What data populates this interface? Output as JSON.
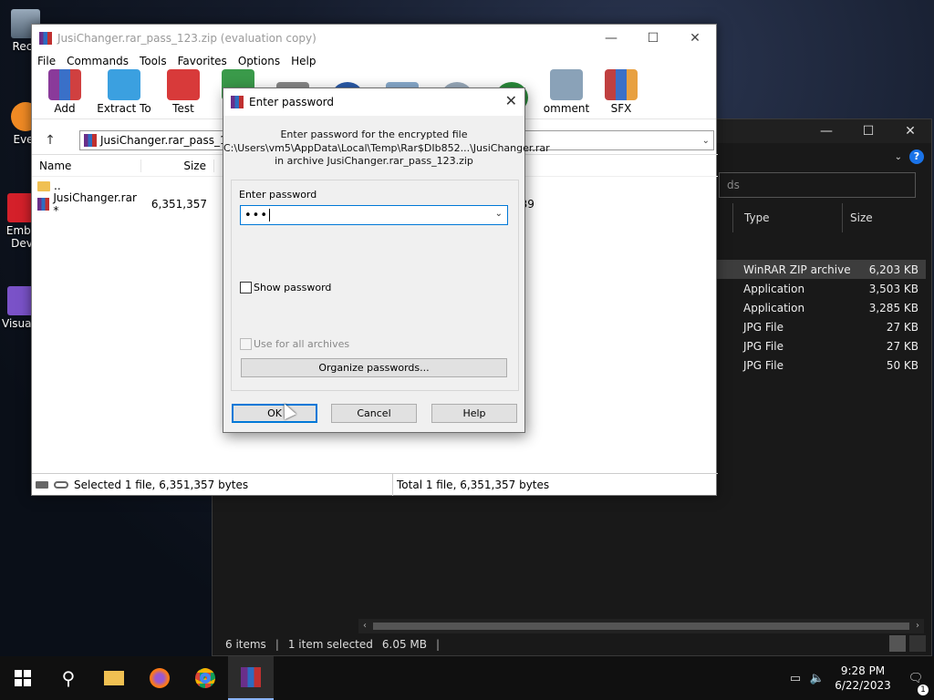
{
  "desktop": {
    "icons": [
      {
        "label": "Recy"
      },
      {
        "label": "Ever"
      },
      {
        "label": "Emba Dev"
      },
      {
        "label": "Visua 2"
      }
    ]
  },
  "explorer": {
    "search_placeholder": "ds",
    "columns": {
      "type": "Type",
      "size": "Size"
    },
    "rows": [
      {
        "type": "WinRAR ZIP archive",
        "size": "6,203 KB"
      },
      {
        "type": "Application",
        "size": "3,503 KB"
      },
      {
        "type": "Application",
        "size": "3,285 KB"
      },
      {
        "type": "JPG File",
        "size": "27 KB"
      },
      {
        "type": "JPG File",
        "size": "27 KB"
      },
      {
        "type": "JPG File",
        "size": "50 KB"
      }
    ],
    "status": {
      "items": "6 items",
      "selected": "1 item selected",
      "size": "6.05 MB"
    }
  },
  "winrar": {
    "title": "JusiChanger.rar_pass_123.zip (evaluation copy)",
    "menu": [
      "File",
      "Commands",
      "Tools",
      "Favorites",
      "Options",
      "Help"
    ],
    "toolbar": [
      "Add",
      "Extract To",
      "Test",
      "Vi",
      "",
      "",
      "",
      "",
      "omment",
      "SFX"
    ],
    "path": "JusiChanger.rar_pass_123",
    "columns": {
      "name": "Name",
      "size": "Size"
    },
    "rows": [
      {
        "name": "..",
        "size": ""
      },
      {
        "name": "JusiChanger.rar *",
        "size": "6,351,357",
        "extra": "139"
      }
    ],
    "status_left": "Selected 1 file, 6,351,357 bytes",
    "status_right": "Total 1 file, 6,351,357 bytes"
  },
  "dialog": {
    "title": "Enter password",
    "info_line1": "Enter password for the encrypted file",
    "info_line2": "C:\\Users\\vm5\\AppData\\Local\\Temp\\Rar$DIb852...\\JusiChanger.rar",
    "info_line3": "in archive JusiChanger.rar_pass_123.zip",
    "field_label": "Enter password",
    "password_mask": "•••",
    "show_password": "Show password",
    "use_for_all": "Use for all archives",
    "organize": "Organize passwords...",
    "ok": "OK",
    "cancel": "Cancel",
    "help": "Help"
  },
  "taskbar": {
    "time": "9:28 PM",
    "date": "6/22/2023",
    "notification_count": "1"
  }
}
